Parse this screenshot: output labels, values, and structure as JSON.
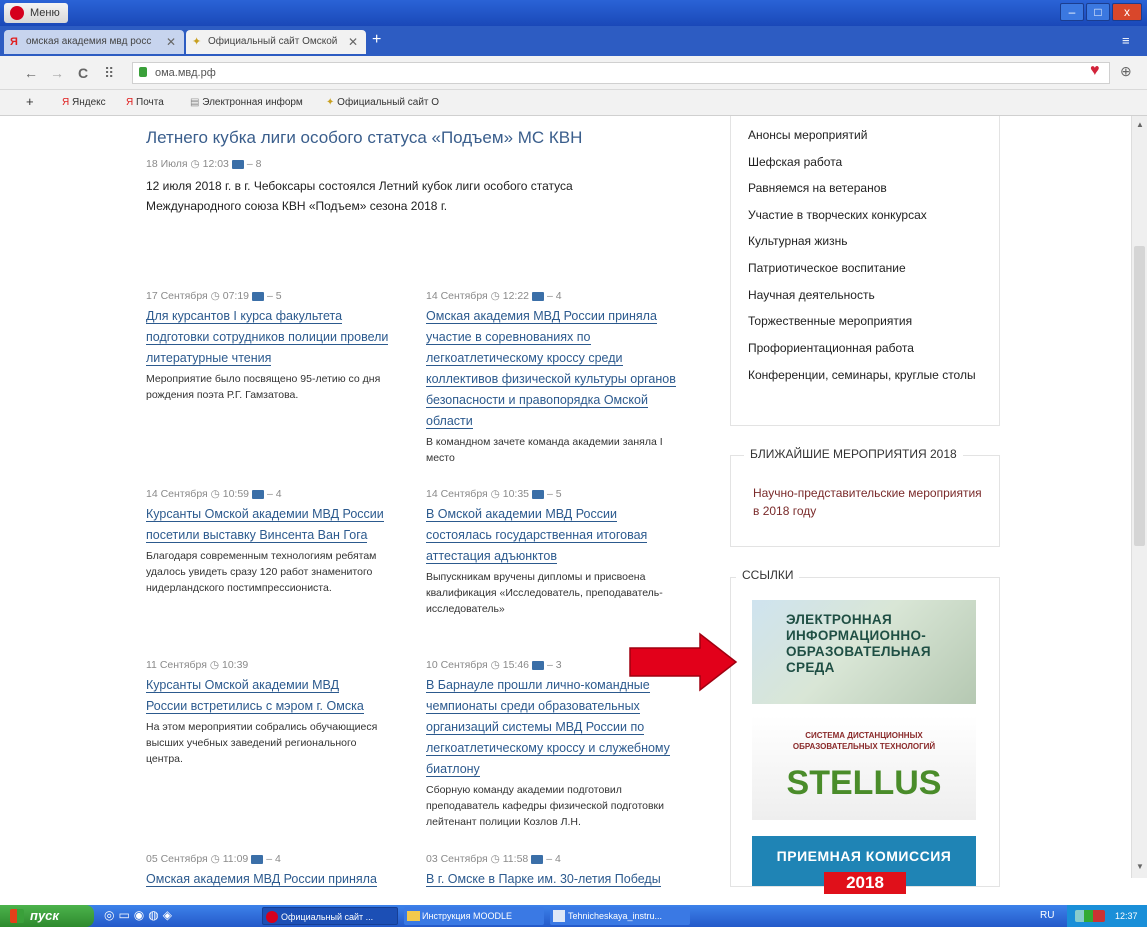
{
  "window": {
    "menu_label": "Меню",
    "minimize": "–",
    "maximize": "□",
    "close": "x"
  },
  "tabs": [
    {
      "label": "омская академия мвд росс",
      "close": "✕"
    },
    {
      "label": "Официальный сайт Омской",
      "close": "✕"
    }
  ],
  "new_tab": "+",
  "address": {
    "url": "омa.мвд.рф",
    "back": "←",
    "forward": "→",
    "reload": "C",
    "grid": "⠿",
    "heart": "♥",
    "download": "⊕",
    "tabs_menu": "≡"
  },
  "bookmarks": {
    "plus": "+",
    "items": [
      "Яндекс",
      "Почта",
      "Электронная информ",
      "Официальный сайт О"
    ]
  },
  "top_news": {
    "title": "Летнего кубка лиги особого статуса «Подъем» МС КВН",
    "date": "18 Июля",
    "time": "12:03",
    "photos": "– 8",
    "lead": "12 июля 2018 г. в г. Чебоксары состоялся Летний кубок лиги особого статуса Международного союза КВН «Подъем» сезона 2018 г."
  },
  "news": [
    {
      "date": "17 Сентября",
      "time": "07:19",
      "photos": "– 5",
      "title": "Для курсантов I курса факультета подготовки сотрудников полиции провели литературные чтения",
      "desc": "Мероприятие было посвящено 95-летию со дня рождения поэта Р.Г. Гамзатова."
    },
    {
      "date": "14 Сентября",
      "time": "12:22",
      "photos": "– 4",
      "title": "Омская академия МВД России приняла участие в соревнованиях по легкоатлетическому кроссу среди коллективов физической культуры органов безопасности и правопорядка Омской области",
      "desc": "В командном зачете команда академии заняла I место"
    },
    {
      "date": "14 Сентября",
      "time": "10:59",
      "photos": "– 4",
      "title": "Курсанты Омской академии МВД России посетили выставку Винсента Ван Гога",
      "desc": "Благодаря современным технологиям ребятам удалось увидеть сразу 120 работ знаменитого нидерландского постимпрессиониста."
    },
    {
      "date": "14 Сентября",
      "time": "10:35",
      "photos": "– 5",
      "title": "В Омской академии МВД России состоялась государственная итоговая аттестация адъюнктов",
      "desc": "Выпускникам вручены дипломы и присвоена квалификация «Исследователь, преподаватель-исследователь»"
    },
    {
      "date": "11 Сентября",
      "time": "10:39",
      "photos": "",
      "title": "Курсанты Омской академии МВД России встретились с мэром г. Омска",
      "desc": "На этом мероприятии собрались обучающиеся высших учебных заведений регионального центра."
    },
    {
      "date": "10 Сентября",
      "time": "15:46",
      "photos": "– 3",
      "title": "В Барнауле прошли лично-командные чемпионаты среди образовательных организаций системы МВД России по легкоатлетическому кроссу и служебному биатлону",
      "desc": "Сборную команду академии подготовил преподаватель кафедры физической подготовки лейтенант полиции Козлов Л.Н."
    },
    {
      "date": "05 Сентября",
      "time": "11:09",
      "photos": "– 4",
      "title": "Омская академия МВД России приняла",
      "desc": ""
    },
    {
      "date": "03 Сентября",
      "time": "11:58",
      "photos": "– 4",
      "title": "В г. Омске в Парке им. 30-летия Победы",
      "desc": ""
    }
  ],
  "categories": [
    "Анонсы мероприятий",
    "Шефская работа",
    "Равняемся на ветеранов",
    "Участие в творческих конкурсах",
    "Культурная жизнь",
    "Патриотическое воспитание",
    "Научная деятельность",
    "Торжественные мероприятия",
    "Профориентационная работа",
    "Конференции, семинары, круглые столы"
  ],
  "events_box": {
    "heading": "БЛИЖАЙШИЕ МЕРОПРИЯТИЯ 2018",
    "link": "Научно-представительские мероприятия в 2018 году"
  },
  "links_box": {
    "heading": "ССЫЛКИ",
    "banner1": [
      "Электронная",
      "Информационно-",
      "Образовательная",
      "Среда"
    ],
    "banner2_top": "СИСТЕМА ДИСТАНЦИОННЫХ ОБРАЗОВАТЕЛЬНЫХ ТЕХНОЛОГИЙ",
    "banner2_name": "STELLUS",
    "banner3_title": "ПРИЕМНАЯ КОМИССИЯ",
    "banner3_year": "2018"
  },
  "taskbar": {
    "start": "пуск",
    "items": [
      "Официальный сайт ...",
      "Инструкция MOODLE",
      "Tehnicheskaya_instru..."
    ],
    "lang": "RU",
    "clock": "12:37"
  },
  "colors": {
    "accent_link": "#2c5a8e",
    "arrow": "#e2001a",
    "titlebar": "#2a63d6"
  }
}
